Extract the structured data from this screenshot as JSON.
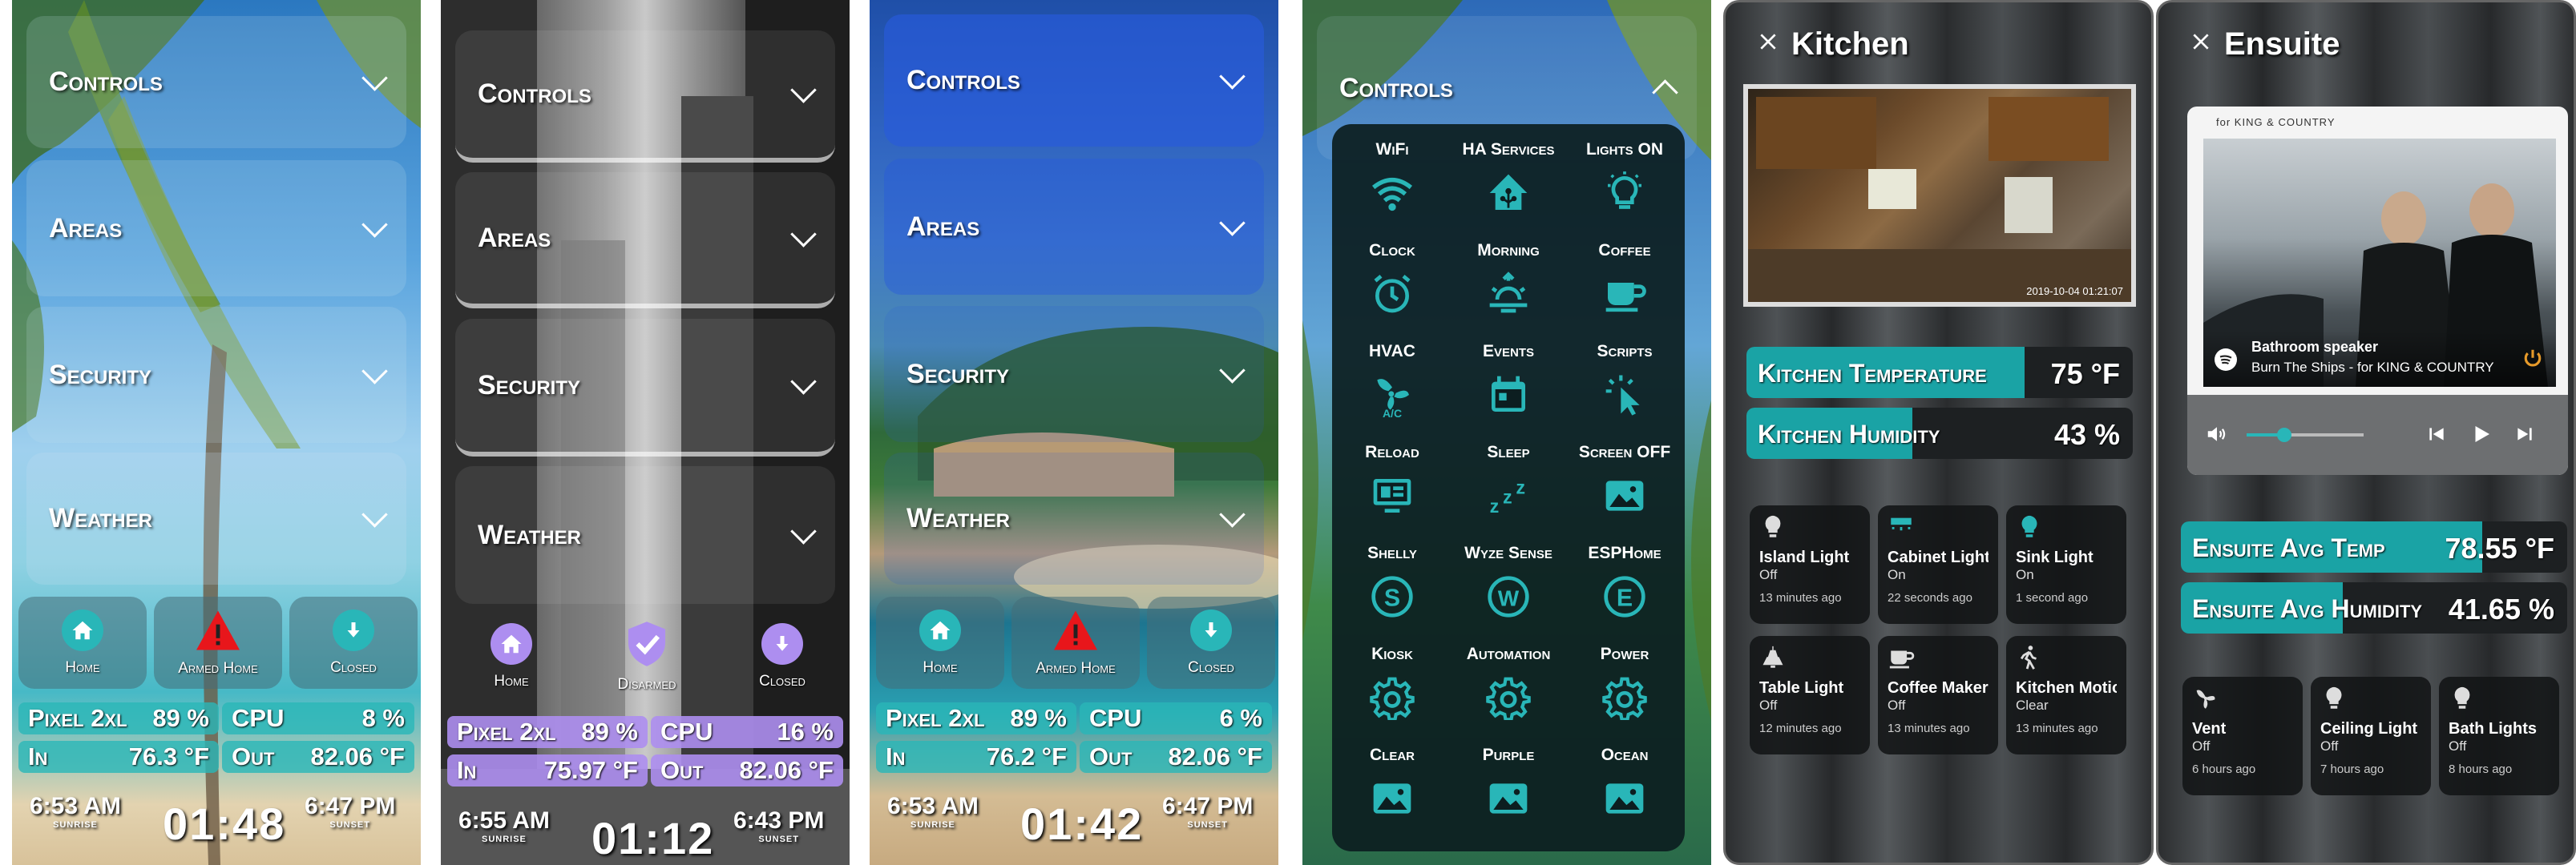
{
  "panels": [
    {
      "sections": [
        "Controls",
        "Areas",
        "Security",
        "Weather"
      ],
      "badges": [
        "Home",
        "Armed Home",
        "Closed"
      ],
      "stats": {
        "pixel_label": "Pixel 2xl",
        "pixel_value": "89 %",
        "cpu_label": "CPU",
        "cpu_value": "8 %",
        "in_label": "In",
        "in_value": "76.3 °F",
        "out_label": "Out",
        "out_value": "82.06 °F"
      },
      "sunrise": "6:53 AM",
      "sunrise_cap": "SUNRISE",
      "clock": "01:48",
      "sunset": "6:47 PM",
      "sunset_cap": "SUNSET"
    },
    {
      "sections": [
        "Controls",
        "Areas",
        "Security",
        "Weather"
      ],
      "badges": [
        "Home",
        "Disarmed",
        "Closed"
      ],
      "stats": {
        "pixel_label": "Pixel 2xl",
        "pixel_value": "89 %",
        "cpu_label": "CPU",
        "cpu_value": "16 %",
        "in_label": "In",
        "in_value": "75.97 °F",
        "out_label": "Out",
        "out_value": "82.06 °F"
      },
      "sunrise": "6:55 AM",
      "sunrise_cap": "SUNRISE",
      "clock": "01:12",
      "sunset": "6:43 PM",
      "sunset_cap": "SUNSET"
    },
    {
      "sections": [
        "Controls",
        "Areas",
        "Security",
        "Weather"
      ],
      "badges": [
        "Home",
        "Armed Home",
        "Closed"
      ],
      "stats": {
        "pixel_label": "Pixel 2xl",
        "pixel_value": "89 %",
        "cpu_label": "CPU",
        "cpu_value": "6 %",
        "in_label": "In",
        "in_value": "76.2 °F",
        "out_label": "Out",
        "out_value": "82.06 °F"
      },
      "sunrise": "6:53 AM",
      "sunrise_cap": "SUNRISE",
      "clock": "01:42",
      "sunset": "6:47 PM",
      "sunset_cap": "SUNSET"
    }
  ],
  "controls": {
    "title": "Controls",
    "items": [
      {
        "label": "WiFi",
        "icon": "wifi-icon"
      },
      {
        "label": "HA Services",
        "icon": "home-assistant-icon"
      },
      {
        "label": "Lights ON",
        "icon": "lightbulb-icon"
      },
      {
        "label": "Clock",
        "icon": "alarm-clock-icon"
      },
      {
        "label": "Morning",
        "icon": "sunrise-icon"
      },
      {
        "label": "Coffee",
        "icon": "coffee-icon"
      },
      {
        "label": "HVAC",
        "icon": "fan-ac-icon"
      },
      {
        "label": "Events",
        "icon": "calendar-icon"
      },
      {
        "label": "Scripts",
        "icon": "cursor-click-icon"
      },
      {
        "label": "Reload",
        "icon": "monitor-icon"
      },
      {
        "label": "Sleep",
        "icon": "sleep-icon"
      },
      {
        "label": "Screen OFF",
        "icon": "image-icon"
      },
      {
        "label": "Shelly",
        "icon": "letter-s-icon"
      },
      {
        "label": "Wyze Sense",
        "icon": "letter-w-icon"
      },
      {
        "label": "ESPHome",
        "icon": "letter-e-icon"
      },
      {
        "label": "Kiosk",
        "icon": "gear-icon"
      },
      {
        "label": "Automation",
        "icon": "gear-icon"
      },
      {
        "label": "Power",
        "icon": "gear-icon"
      },
      {
        "label": "Clear",
        "icon": "image-icon"
      },
      {
        "label": "Purple",
        "icon": "image-icon"
      },
      {
        "label": "Ocean",
        "icon": "image-icon"
      }
    ]
  },
  "kitchen": {
    "title": "Kitchen",
    "camera_timestamp": "2019-10-04 01:21:07",
    "temp_label": "Kitchen Temperature",
    "temp_value": "75 °F",
    "hum_label": "Kitchen Humidity",
    "hum_value": "43 %",
    "tiles": [
      {
        "name": "Island Light",
        "state": "Off",
        "ago": "13 minutes ago",
        "icon": "lightbulb-icon"
      },
      {
        "name": "Cabinet Lights",
        "state": "On",
        "ago": "22 seconds ago",
        "icon": "cabinet-light-icon"
      },
      {
        "name": "Sink Light",
        "state": "On",
        "ago": "1 second ago",
        "icon": "lightbulb-icon"
      },
      {
        "name": "Table Light",
        "state": "Off",
        "ago": "12 minutes ago",
        "icon": "ceiling-lamp-icon"
      },
      {
        "name": "Coffee Maker",
        "state": "Off",
        "ago": "13 minutes ago",
        "icon": "coffee-icon"
      },
      {
        "name": "Kitchen Motion",
        "state": "Clear",
        "ago": "13 minutes ago",
        "icon": "walking-icon"
      }
    ]
  },
  "ensuite": {
    "title": "Ensuite",
    "media_brand": "for KING & COUNTRY",
    "media_device": "Bathroom speaker",
    "media_track": "Burn The Ships - for KING & COUNTRY",
    "temp_label": "Ensuite Avg Temp",
    "temp_value": "78.55 °F",
    "hum_label": "Ensuite Avg Humidity",
    "hum_value": "41.65 %",
    "volume": 0.3,
    "tiles": [
      {
        "name": "Vent",
        "state": "Off",
        "ago": "6 hours ago",
        "icon": "fan-icon"
      },
      {
        "name": "Ceiling Light",
        "state": "Off",
        "ago": "7 hours ago",
        "icon": "lightbulb-icon"
      },
      {
        "name": "Bath Lights",
        "state": "Off",
        "ago": "8 hours ago",
        "icon": "lightbulb-icon"
      }
    ]
  },
  "colors": {
    "accent": "#29b6b8",
    "accent2": "#ad8ef0",
    "alert": "#e8161b"
  }
}
